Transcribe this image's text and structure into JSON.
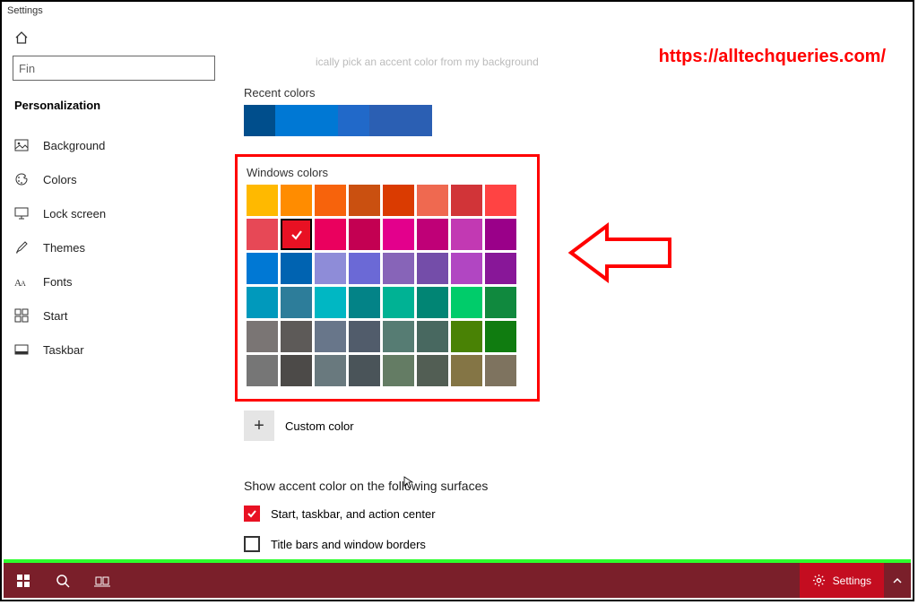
{
  "window": {
    "title": "Settings"
  },
  "watermark": "https://alltechqueries.com/",
  "search": {
    "placeholder": "Fin"
  },
  "sidebar": {
    "section": "Personalization",
    "items": [
      {
        "label": "Background"
      },
      {
        "label": "Colors"
      },
      {
        "label": "Lock screen"
      },
      {
        "label": "Themes"
      },
      {
        "label": "Fonts"
      },
      {
        "label": "Start"
      },
      {
        "label": "Taskbar"
      }
    ]
  },
  "content": {
    "faded_text": "ically pick an accent color from my background",
    "recent_label": "Recent colors",
    "recent_colors": [
      "#004e8c",
      "#0078d4",
      "#0078d4",
      "#2169c9",
      "#2b5fb3",
      "#2b5fb3"
    ],
    "windows_label": "Windows colors",
    "windows_colors": [
      [
        "#ffb900",
        "#ff8c00",
        "#f7630c",
        "#ca5010",
        "#da3b01",
        "#ef6950",
        "#d13438",
        "#ff4343"
      ],
      [
        "#e74856",
        "#e81123",
        "#ea005e",
        "#c30052",
        "#e3008c",
        "#bf0077",
        "#c239b3",
        "#9a0089"
      ],
      [
        "#0078d4",
        "#0063b1",
        "#8e8cd8",
        "#6b69d6",
        "#8764b8",
        "#744da9",
        "#b146c2",
        "#881798"
      ],
      [
        "#0099bc",
        "#2d7d9a",
        "#00b7c3",
        "#038387",
        "#00b294",
        "#018574",
        "#00cc6a",
        "#10893e"
      ],
      [
        "#7a7574",
        "#5d5a58",
        "#68768a",
        "#515c6b",
        "#567c73",
        "#486860",
        "#498205",
        "#107c10"
      ],
      [
        "#767676",
        "#4c4a48",
        "#69797e",
        "#4a5459",
        "#647c64",
        "#525e54",
        "#847545",
        "#7e735f"
      ]
    ],
    "selected": {
      "row": 1,
      "col": 1
    },
    "custom_label": "Custom color",
    "surfaces_heading": "Show accent color on the following surfaces",
    "opt_start": "Start, taskbar, and action center",
    "opt_title": "Title bars and window borders"
  },
  "taskbar": {
    "settings_label": "Settings"
  }
}
